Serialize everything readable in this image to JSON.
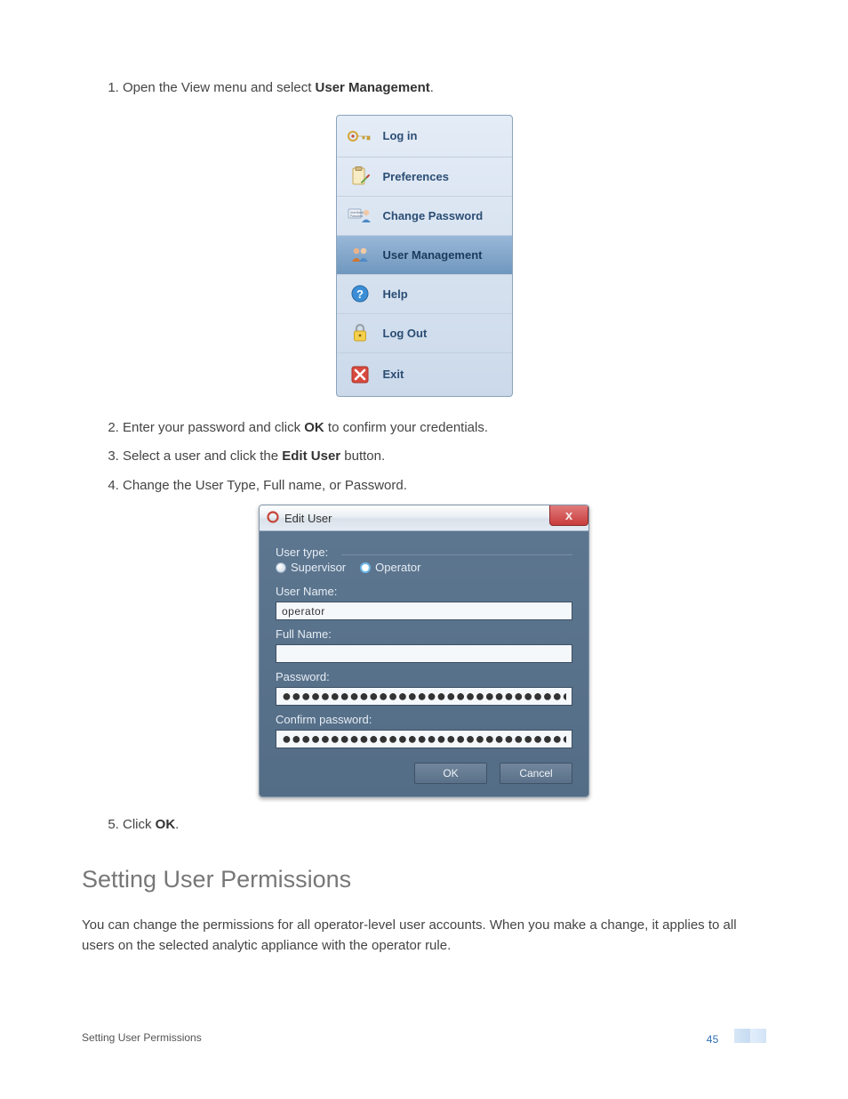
{
  "steps": {
    "s1a": "Open the View menu and select ",
    "s1b": "User Management",
    "s1c": ".",
    "s2a": "Enter your password and click ",
    "s2b": "OK",
    "s2c": " to confirm your credentials.",
    "s3a": "Select a user and click the ",
    "s3b": "Edit User",
    "s3c": " button.",
    "s4": "Change the User Type, Full name, or Password.",
    "s5a": "Click ",
    "s5b": "OK",
    "s5c": "."
  },
  "viewMenu": {
    "items": [
      {
        "label": "Log in"
      },
      {
        "label": "Preferences"
      },
      {
        "label": "Change Password"
      },
      {
        "label": "User Management"
      },
      {
        "label": "Help"
      },
      {
        "label": "Log Out"
      },
      {
        "label": "Exit"
      }
    ]
  },
  "editDialog": {
    "title": "Edit User",
    "userTypeLabel": "User type:",
    "supervisor": "Supervisor",
    "operator": "Operator",
    "userNameLabel": "User Name:",
    "userNameValue": "operator",
    "fullNameLabel": "Full Name:",
    "fullNameValue": "",
    "passwordLabel": "Password:",
    "passwordValue": "●●●●●●●●●●●●●●●●●●●●●●●●●●●●●●",
    "confirmLabel": "Confirm password:",
    "confirmValue": "●●●●●●●●●●●●●●●●●●●●●●●●●●●●●●",
    "ok": "OK",
    "cancel": "Cancel"
  },
  "sectionHeading": "Setting User Permissions",
  "sectionPara": "You can change the permissions for all operator-level user accounts. When you make a change, it applies to all users on the selected analytic appliance with the operator rule.",
  "footer": {
    "title": "Setting User Permissions",
    "page": "45"
  }
}
